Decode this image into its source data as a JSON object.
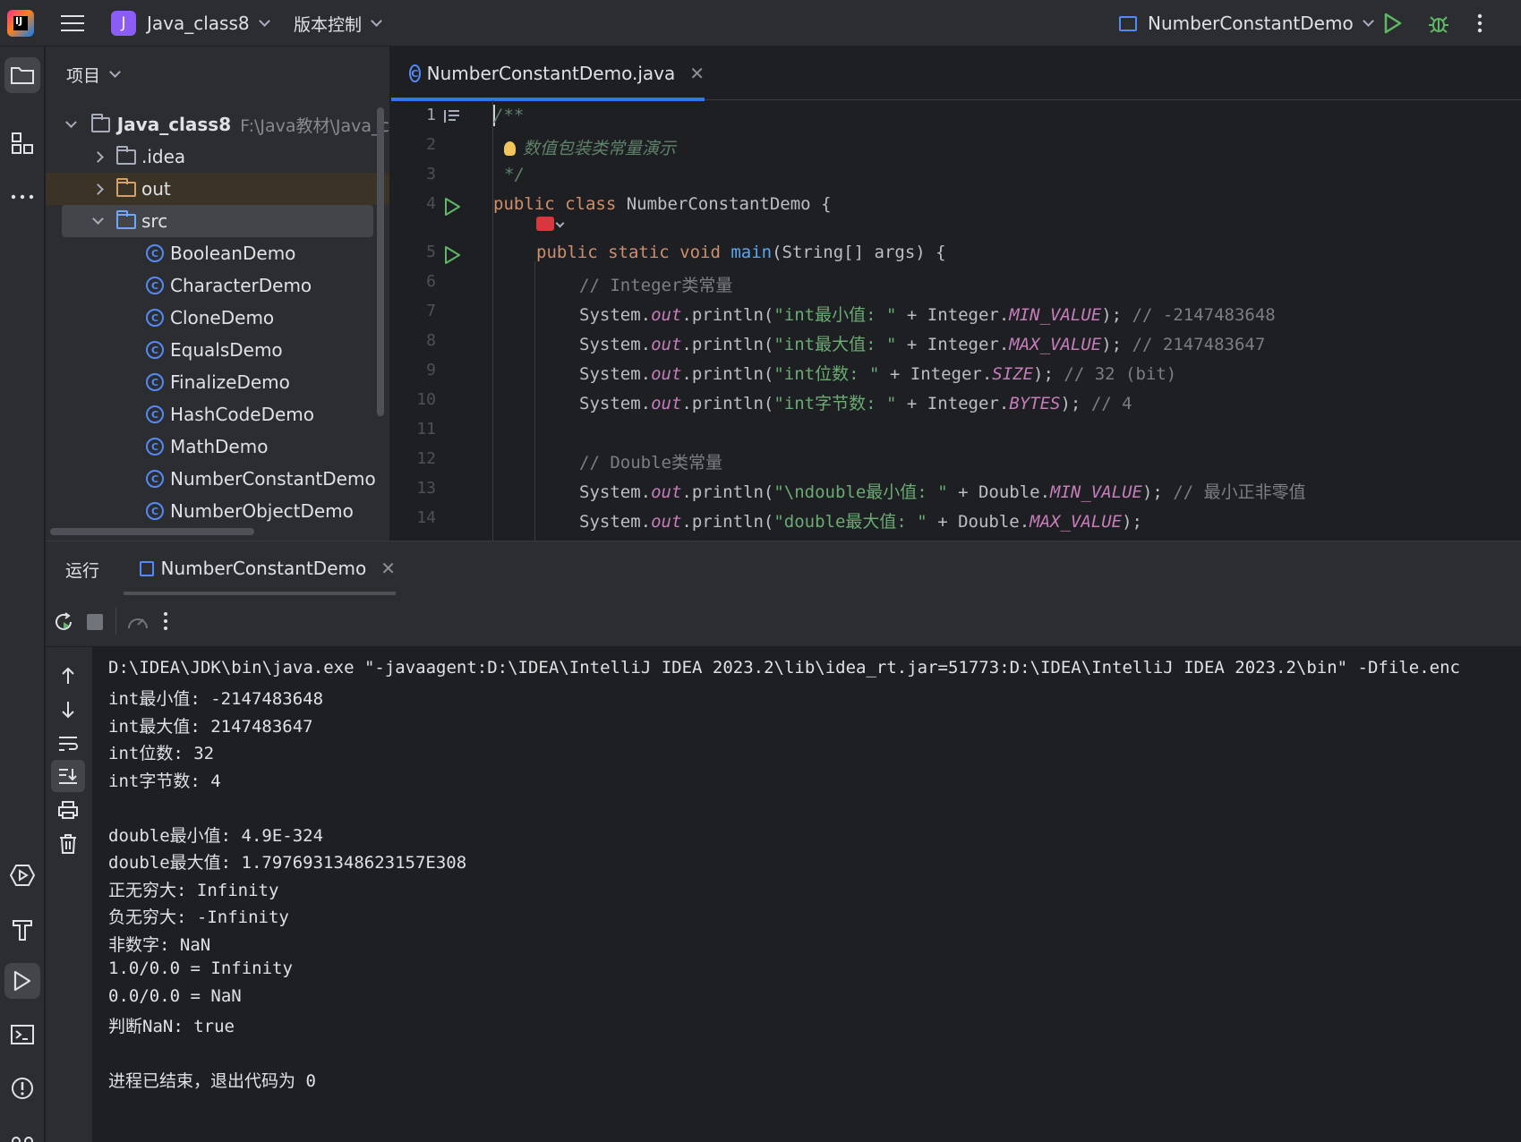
{
  "topbar": {
    "project_badge": "J",
    "project_name": "Java_class8",
    "vcs_label": "版本控制",
    "run_config": "NumberConstantDemo"
  },
  "project_panel": {
    "title": "项目",
    "root": {
      "name": "Java_class8",
      "path": "F:\\Java教材\\Java_c"
    },
    "items": [
      {
        "label": ".idea",
        "type": "folder"
      },
      {
        "label": "out",
        "type": "folder"
      },
      {
        "label": "src",
        "type": "folder"
      },
      {
        "label": "BooleanDemo",
        "type": "class"
      },
      {
        "label": "CharacterDemo",
        "type": "class"
      },
      {
        "label": "CloneDemo",
        "type": "class"
      },
      {
        "label": "EqualsDemo",
        "type": "class"
      },
      {
        "label": "FinalizeDemo",
        "type": "class"
      },
      {
        "label": "HashCodeDemo",
        "type": "class"
      },
      {
        "label": "MathDemo",
        "type": "class"
      },
      {
        "label": "NumberConstantDemo",
        "type": "class"
      },
      {
        "label": "NumberObjectDemo",
        "type": "class"
      }
    ]
  },
  "editor": {
    "tab_label": "NumberConstantDemo.java",
    "line_numbers": [
      "1",
      "2",
      "3",
      "4",
      "5",
      "6",
      "7",
      "8",
      "9",
      "10",
      "11",
      "12",
      "13",
      "14"
    ],
    "doc_comment": "数值包装类常量演示",
    "class_name": "NumberConstantDemo",
    "comment_integer": "// Integer类常量",
    "comment_double": "// Double类常量",
    "lines": {
      "l7_str": "\"int最小值: \"",
      "l7_field": "MIN_VALUE",
      "l7_cmt": "// -2147483648",
      "l8_str": "\"int最大值: \"",
      "l8_field": "MAX_VALUE",
      "l8_cmt": "// 2147483647",
      "l9_str": "\"int位数: \"",
      "l9_field": "SIZE",
      "l9_cmt": "// 32 (bit)",
      "l10_str": "\"int字节数: \"",
      "l10_field": "BYTES",
      "l10_cmt": "// 4",
      "l13_str": "\"\\ndouble最小值: \"",
      "l13_field": "MIN_VALUE",
      "l13_cmt": "// 最小正非零值",
      "l14_str": "\"double最大值: \"",
      "l14_field": "MAX_VALUE"
    }
  },
  "run_panel": {
    "title": "运行",
    "tab_label": "NumberConstantDemo",
    "output": [
      "D:\\IDEA\\JDK\\bin\\java.exe \"-javaagent:D:\\IDEA\\IntelliJ IDEA 2023.2\\lib\\idea_rt.jar=51773:D:\\IDEA\\IntelliJ IDEA 2023.2\\bin\" -Dfile.enc",
      "int最小值: -2147483648",
      "int最大值: 2147483647",
      "int位数: 32",
      "int字节数: 4",
      "",
      "double最小值: 4.9E-324",
      "double最大值: 1.7976931348623157E308",
      "正无穷大: Infinity",
      "负无穷大: -Infinity",
      "非数字: NaN",
      "1.0/0.0 = Infinity",
      "0.0/0.0 = NaN",
      "判断NaN: true",
      "",
      "进程已结束，退出代码为 0"
    ]
  },
  "colors": {
    "accent": "#3574f0",
    "run_green": "#5fb865",
    "badge_purple": "#8b5cf6"
  }
}
